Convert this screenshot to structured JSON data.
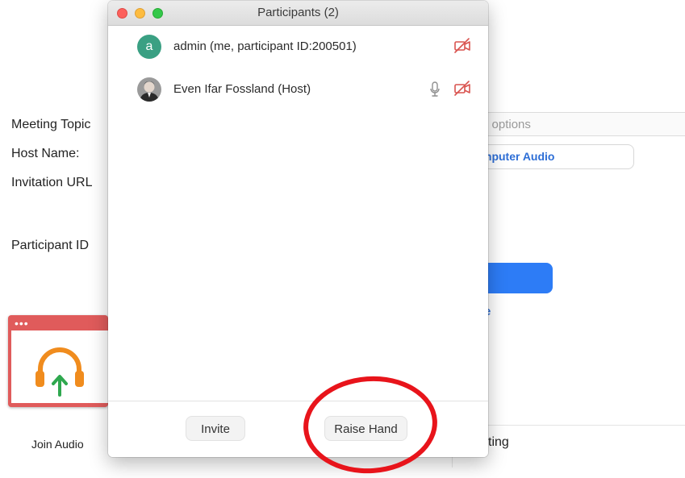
{
  "background": {
    "labels": {
      "meeting_topic": "Meeting Topic",
      "host_name": "Host Name:",
      "invitation_url": "Invitation URL",
      "participant_id": "Participant ID"
    },
    "options_text": "e options",
    "computer_audio": "mputer Audio",
    "blue_link_fragment": "e",
    "ting_text": "ting",
    "join_audio": "Join Audio",
    "card_dots": "•••"
  },
  "participants_window": {
    "title": "Participants (2)",
    "participants": [
      {
        "initial": "a",
        "name": "admin (me, participant ID:200501)",
        "avatar_color": "#3aa083",
        "video_icon": "video-off-icon"
      },
      {
        "name": "Even Ifar Fossland (Host)",
        "avatar": "photo",
        "audio_icon": "microphone-icon",
        "video_icon": "video-off-icon"
      }
    ],
    "buttons": {
      "invite": "Invite",
      "raise_hand": "Raise Hand"
    }
  },
  "colors": {
    "video_off": "#d9534f",
    "annotation": "#e8141b",
    "accent_blue": "#2d7cf6"
  }
}
